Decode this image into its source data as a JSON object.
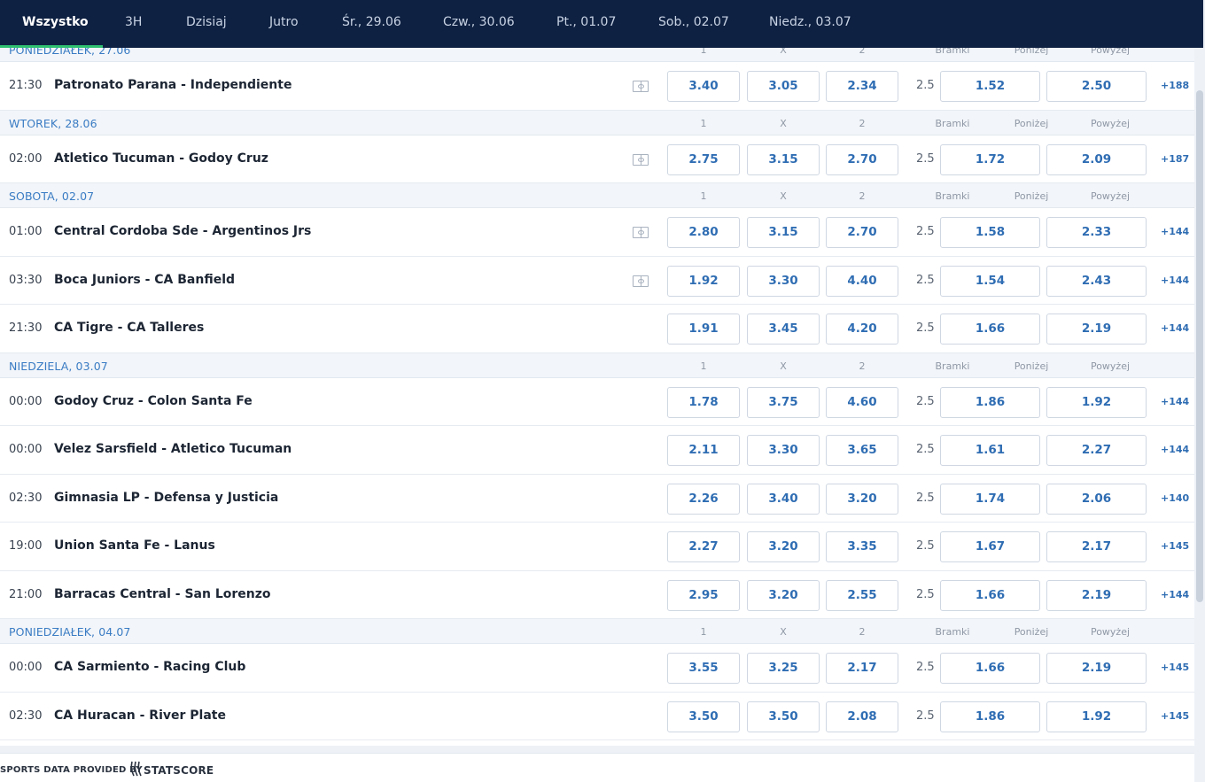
{
  "nav": {
    "tabs": [
      {
        "label": "Wszystko",
        "active": true
      },
      {
        "label": "3H"
      },
      {
        "label": "Dzisiaj"
      },
      {
        "label": "Jutro"
      },
      {
        "label": "Śr., 29.06"
      },
      {
        "label": "Czw., 30.06"
      },
      {
        "label": "Pt., 01.07"
      },
      {
        "label": "Sob., 02.07"
      },
      {
        "label": "Niedz., 03.07"
      }
    ]
  },
  "columns": {
    "c1": "1",
    "cx": "X",
    "c2": "2",
    "goals": "Bramki",
    "under": "Poniżej",
    "over": "Powyżej"
  },
  "days": [
    {
      "label": "PONIEDZIAŁEK, 27.06",
      "matches": [
        {
          "time": "21:30",
          "teams": "Patronato Parana - Independiente",
          "stats": true,
          "o1": "3.40",
          "ox": "3.05",
          "o2": "2.34",
          "line": "2.5",
          "under": "1.52",
          "over": "2.50",
          "more": "+188"
        }
      ]
    },
    {
      "label": "WTOREK, 28.06",
      "matches": [
        {
          "time": "02:00",
          "teams": "Atletico Tucuman - Godoy Cruz",
          "stats": true,
          "o1": "2.75",
          "ox": "3.15",
          "o2": "2.70",
          "line": "2.5",
          "under": "1.72",
          "over": "2.09",
          "more": "+187"
        }
      ]
    },
    {
      "label": "SOBOTA, 02.07",
      "matches": [
        {
          "time": "01:00",
          "teams": "Central Cordoba Sde - Argentinos Jrs",
          "stats": true,
          "o1": "2.80",
          "ox": "3.15",
          "o2": "2.70",
          "line": "2.5",
          "under": "1.58",
          "over": "2.33",
          "more": "+144"
        },
        {
          "time": "03:30",
          "teams": "Boca Juniors - CA Banfield",
          "stats": true,
          "o1": "1.92",
          "ox": "3.30",
          "o2": "4.40",
          "line": "2.5",
          "under": "1.54",
          "over": "2.43",
          "more": "+144"
        },
        {
          "time": "21:30",
          "teams": "CA Tigre - CA Talleres",
          "stats": false,
          "o1": "1.91",
          "ox": "3.45",
          "o2": "4.20",
          "line": "2.5",
          "under": "1.66",
          "over": "2.19",
          "more": "+144"
        }
      ]
    },
    {
      "label": "NIEDZIELA, 03.07",
      "matches": [
        {
          "time": "00:00",
          "teams": "Godoy Cruz - Colon Santa Fe",
          "stats": false,
          "o1": "1.78",
          "ox": "3.75",
          "o2": "4.60",
          "line": "2.5",
          "under": "1.86",
          "over": "1.92",
          "more": "+144"
        },
        {
          "time": "00:00",
          "teams": "Velez Sarsfield - Atletico Tucuman",
          "stats": false,
          "o1": "2.11",
          "ox": "3.30",
          "o2": "3.65",
          "line": "2.5",
          "under": "1.61",
          "over": "2.27",
          "more": "+144"
        },
        {
          "time": "02:30",
          "teams": "Gimnasia LP - Defensa y Justicia",
          "stats": false,
          "o1": "2.26",
          "ox": "3.40",
          "o2": "3.20",
          "line": "2.5",
          "under": "1.74",
          "over": "2.06",
          "more": "+140"
        },
        {
          "time": "19:00",
          "teams": "Union Santa Fe - Lanus",
          "stats": false,
          "o1": "2.27",
          "ox": "3.20",
          "o2": "3.35",
          "line": "2.5",
          "under": "1.67",
          "over": "2.17",
          "more": "+145"
        },
        {
          "time": "21:00",
          "teams": "Barracas Central - San Lorenzo",
          "stats": false,
          "o1": "2.95",
          "ox": "3.20",
          "o2": "2.55",
          "line": "2.5",
          "under": "1.66",
          "over": "2.19",
          "more": "+144"
        }
      ]
    },
    {
      "label": "PONIEDZIAŁEK, 04.07",
      "matches": [
        {
          "time": "00:00",
          "teams": "CA Sarmiento - Racing Club",
          "stats": false,
          "o1": "3.55",
          "ox": "3.25",
          "o2": "2.17",
          "line": "2.5",
          "under": "1.66",
          "over": "2.19",
          "more": "+145"
        },
        {
          "time": "02:30",
          "teams": "CA Huracan - River Plate",
          "stats": false,
          "o1": "3.50",
          "ox": "3.50",
          "o2": "2.08",
          "line": "2.5",
          "under": "1.86",
          "over": "1.92",
          "more": "+145"
        }
      ]
    }
  ],
  "footer": {
    "provided_by": "SPORTS DATA PROVIDED BY",
    "provider": "STATSCORE"
  },
  "colors": {
    "nav_bg": "#0f2142",
    "accent": "#2fc171",
    "odds_text": "#2f6db3",
    "day_label": "#3a7cc4"
  }
}
